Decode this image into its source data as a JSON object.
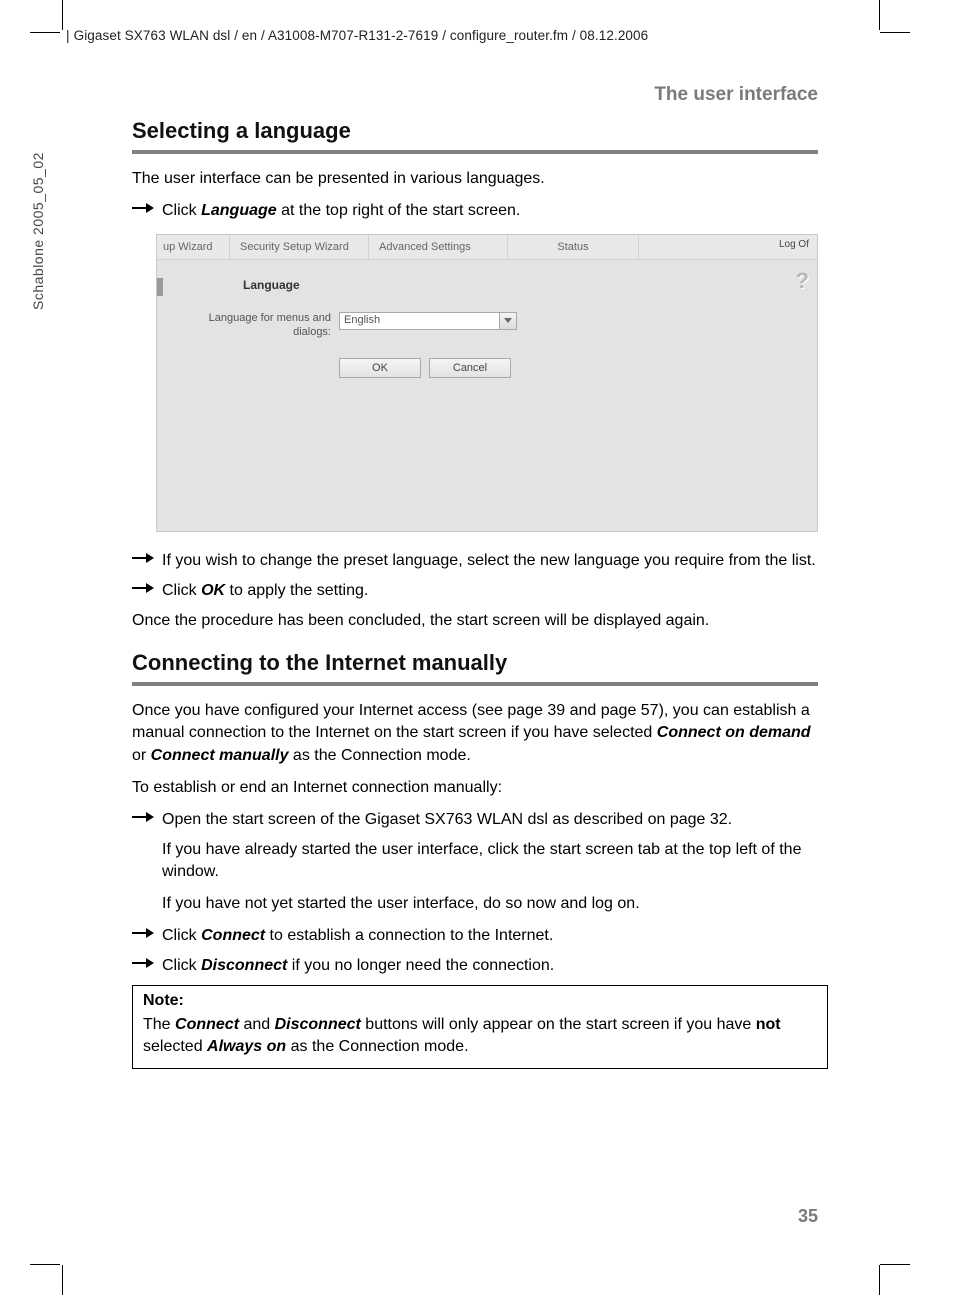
{
  "header_path": "Gigaset SX763 WLAN dsl / en / A31008-M707-R131-2-7619 / configure_router.fm / 08.12.2006",
  "side_label": "Schablone 2005_05_02",
  "chapter_title": "The user interface",
  "page_number": "35",
  "sec1": {
    "heading": "Selecting a language",
    "intro": "The user interface can be presented in various languages.",
    "step1_a": "Click ",
    "step1_b": "Language",
    "step1_c": " at the top right of the start screen.",
    "step2": "If you wish to change the preset language, select the new language you require from the list.",
    "step3_a": "Click ",
    "step3_b": "OK",
    "step3_c": " to apply the setting.",
    "outro": "Once the procedure has been concluded, the start screen will be displayed again."
  },
  "screenshot": {
    "tabs": {
      "t1": "up Wizard",
      "t2": "Security Setup Wizard",
      "t3": "Advanced Settings",
      "t4": "Status"
    },
    "logoff": "Log Of",
    "panel_heading": "Language",
    "field_label": "Language for menus and dialogs:",
    "select_value": "English",
    "btn_ok": "OK",
    "btn_cancel": "Cancel",
    "help": "?"
  },
  "sec2": {
    "heading": "Connecting to the Internet manually",
    "p1_a": "Once you have configured your Internet access (see page 39 and page 57), you can establish a manual connection to the Internet on the start screen if you have selected ",
    "p1_b": "Connect on demand",
    "p1_c": " or ",
    "p1_d": "Connect manually",
    "p1_e": " as the Connection mode.",
    "p2": "To establish or end an Internet connection manually:",
    "s1": "Open the start screen of the Gigaset SX763 WLAN dsl as described on page 32.",
    "s1a": "If you have already started the user interface, click the start screen tab at the top left of the window.",
    "s1b": "If you have not yet started the user interface, do so now and log on.",
    "s2_a": "Click ",
    "s2_b": "Connect",
    "s2_c": " to establish a connection to the Internet.",
    "s3_a": "Click ",
    "s3_b": "Disconnect",
    "s3_c": " if you no longer need the connection."
  },
  "note": {
    "title": "Note:",
    "a": "The ",
    "b": "Connect",
    "c": " and ",
    "d": "Disconnect",
    "e": " buttons will only appear on the start screen if you have ",
    "f": "not",
    "g": " selected ",
    "h": "Always on",
    "i": " as the Connection mode."
  }
}
